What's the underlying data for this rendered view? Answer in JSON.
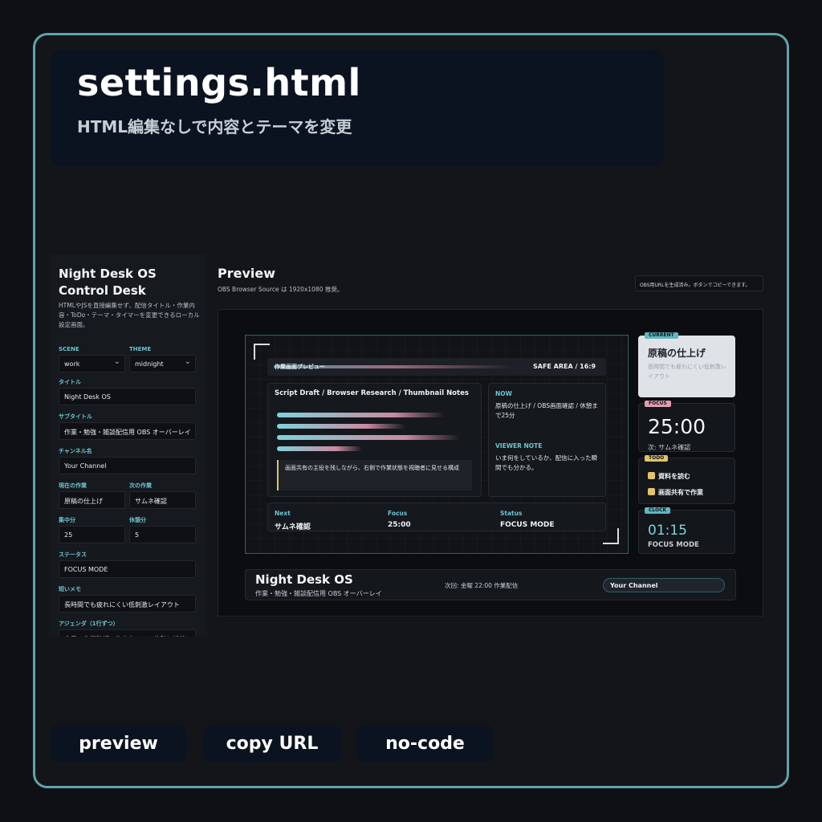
{
  "hero": {
    "title": "settings.html",
    "subtitle": "HTML編集なしで内容とテーマを変更"
  },
  "sidebar": {
    "title": "Night Desk OS Control Desk",
    "description": "HTMLやJSを直接編集せず、配信タイトル・作業内容・ToDo・テーマ・タイマーを変更できるローカル設定画面。",
    "fields": {
      "scene": {
        "label": "SCENE",
        "value": "work"
      },
      "theme": {
        "label": "THEME",
        "value": "midnight"
      },
      "title": {
        "label": "タイトル",
        "value": "Night Desk OS"
      },
      "subtitle": {
        "label": "サブタイトル",
        "value": "作業・勉強・雑談配信用 OBS オーバーレイ"
      },
      "channel": {
        "label": "チャンネル名",
        "value": "Your Channel"
      },
      "current_task": {
        "label": "現在の作業",
        "value": "原稿の仕上げ"
      },
      "next_task": {
        "label": "次の作業",
        "value": "サムネ確認"
      },
      "focus_min": {
        "label": "集中分",
        "value": "25"
      },
      "break_min": {
        "label": "休憩分",
        "value": "5"
      },
      "status": {
        "label": "ステータス",
        "value": "FOCUS MODE"
      },
      "memo": {
        "label": "短いメモ",
        "value": "長時間でも疲れにくい低刺激レイアウト"
      },
      "agenda": {
        "label": "アジェンダ（1行ずつ）",
        "value": "今日の作業確認 / 集中タイム / 休憩と雑談"
      }
    }
  },
  "main": {
    "title": "Preview",
    "subtitle": "OBS Browser Source は 1920x1080 推奨。",
    "url_note": "OBS用URLを生成済み。ボタンでコピーできます。"
  },
  "overlay": {
    "bar_label": "作業画面プレビュー",
    "safe_area": "SAFE AREA / 16:9",
    "work_title": "Script Draft / Browser Research / Thumbnail Notes",
    "quote": "画面共有の主役を残しながら、右側で作業状態を視聴者に見せる構成",
    "now_label": "NOW",
    "now_text": "原稿の仕上げ / OBS画面確認 / 休憩まで25分",
    "viewer_label": "VIEWER NOTE",
    "viewer_text": "いま何をしているか、配信に入った瞬間でも分かる。",
    "footer": [
      {
        "key": "Next",
        "value": "サムネ確認"
      },
      {
        "key": "Focus",
        "value": "25:00"
      },
      {
        "key": "Status",
        "value": "FOCUS MODE"
      }
    ],
    "progress": [
      0.55,
      0.42,
      0.6,
      0.28
    ],
    "current": {
      "tag": "CURRENT",
      "title": "原稿の仕上げ",
      "note": "長時間でも疲れにくい低刺激レイアウト"
    },
    "focus": {
      "tag": "FOCUS",
      "time": "25:00",
      "next": "次: サムネ確認"
    },
    "todo": {
      "tag": "TODO",
      "items": [
        "資料を読む",
        "画面共有で作業"
      ]
    },
    "clock": {
      "tag": "CLOCK",
      "time": "01:15",
      "mode": "FOCUS MODE"
    },
    "bottom": {
      "title": "Night Desk OS",
      "subtitle": "作業・勉強・雑談配信用 OBS オーバーレイ",
      "schedule": "次回: 金曜 22:00 作業配信",
      "channel": "Your Channel"
    }
  },
  "buttons": {
    "preview": "preview",
    "copy_url": "copy URL",
    "no_code": "no-code"
  },
  "colors": {
    "accent": "#5fa3ad",
    "label": "#6cc3cf",
    "focus_tag": "#e59bb0",
    "todo_tag": "#e0c36a"
  }
}
